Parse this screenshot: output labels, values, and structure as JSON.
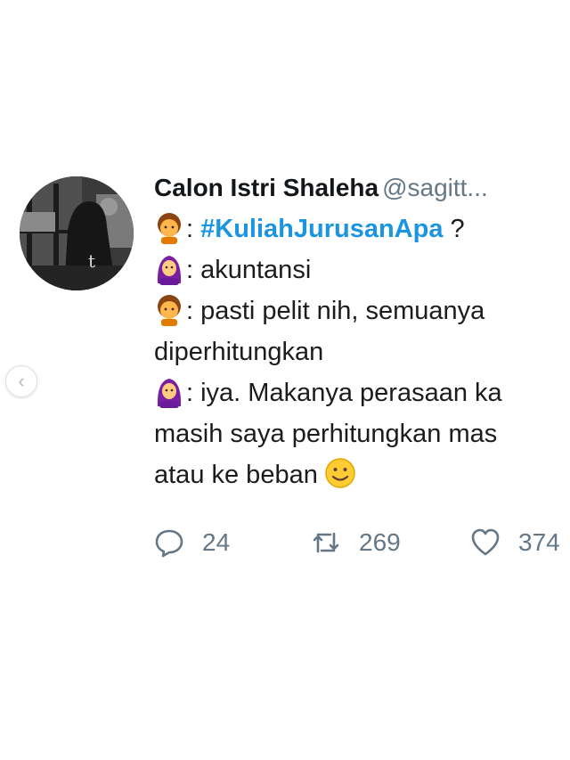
{
  "carousel": {
    "prev_icon": "chevron-left-icon",
    "prev_glyph": "‹"
  },
  "tweet": {
    "author_name": "Calon Istri Shaleha",
    "author_handle": "@sagitt...",
    "avatar_letter": "t",
    "lines": [
      {
        "emoji": "boy-emoji",
        "prefix": ": ",
        "hashtag": "#KuliahJurusanApa",
        "text": " ?"
      },
      {
        "emoji": "woman-hijab-emoji",
        "text": ": akuntansi"
      },
      {
        "emoji": "boy-emoji",
        "text": ": pasti pelit nih, semuanya"
      },
      {
        "text": "diperhitungkan"
      },
      {
        "emoji": "woman-hijab-emoji",
        "text": ": iya. Makanya perasaan ka"
      },
      {
        "text": "masih saya perhitungkan mas"
      },
      {
        "text": "atau ke beban",
        "emoji_after": "slightly-smiling-face-emoji"
      }
    ],
    "stats": {
      "replies": "24",
      "retweets": "269",
      "likes": "374"
    },
    "colors": {
      "link": "#1b95e0",
      "muted": "#657786",
      "text": "#14171a"
    }
  }
}
